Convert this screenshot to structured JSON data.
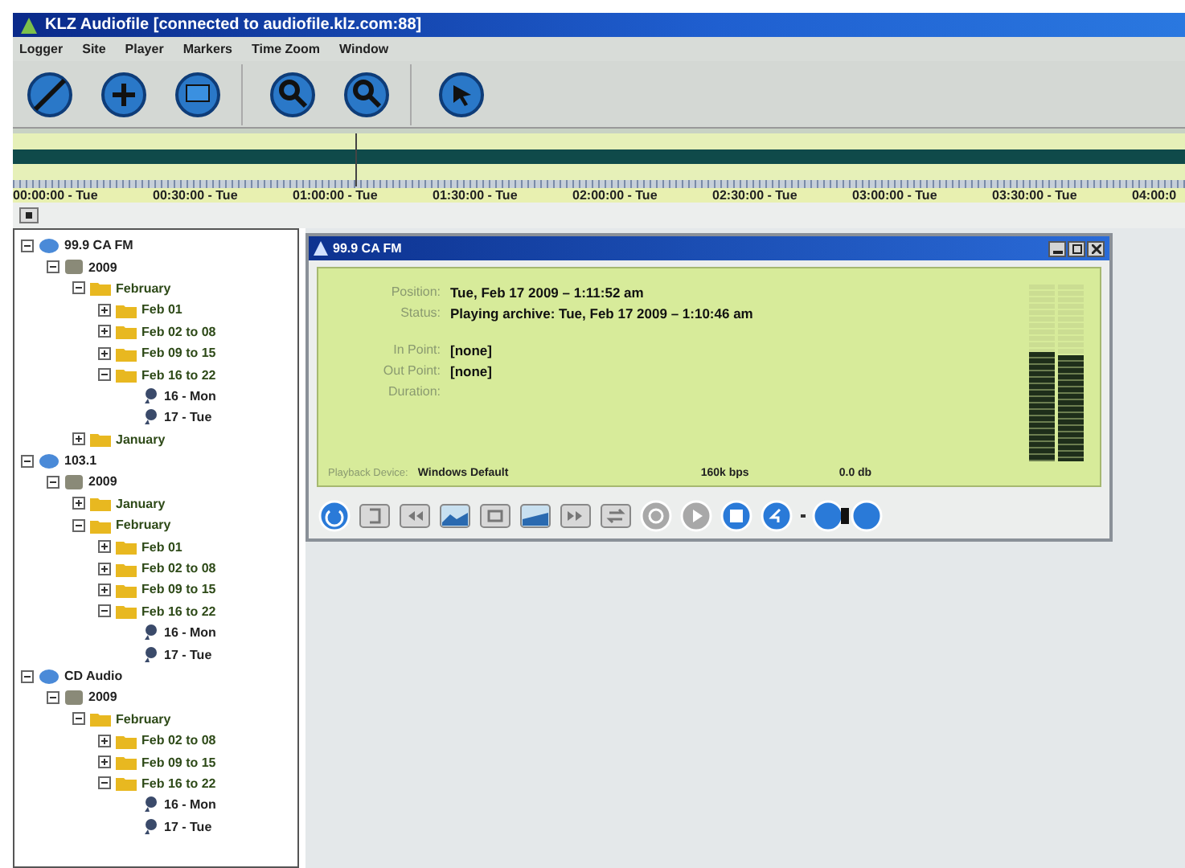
{
  "window": {
    "title": "KLZ Audiofile [connected to audiofile.klz.com:88]"
  },
  "menu": [
    "Logger",
    "Site",
    "Player",
    "Markers",
    "Time Zoom",
    "Window"
  ],
  "timeline": {
    "labels": [
      "00:00:00 - Tue",
      "00:30:00 - Tue",
      "01:00:00 - Tue",
      "01:30:00 - Tue",
      "02:00:00 - Tue",
      "02:30:00 - Tue",
      "03:00:00 - Tue",
      "03:30:00 - Tue",
      "04:00:0"
    ]
  },
  "tree": [
    {
      "label": "99.9 CA FM",
      "kind": "station",
      "expanded": true,
      "children": [
        {
          "label": "2009",
          "kind": "year",
          "expanded": true,
          "children": [
            {
              "label": "February",
              "kind": "folder",
              "expanded": true,
              "children": [
                {
                  "label": "Feb 01",
                  "kind": "folder",
                  "expanded": false
                },
                {
                  "label": "Feb 02 to 08",
                  "kind": "folder",
                  "expanded": false
                },
                {
                  "label": "Feb 09 to 15",
                  "kind": "folder",
                  "expanded": false
                },
                {
                  "label": "Feb 16 to 22",
                  "kind": "folder",
                  "expanded": true,
                  "children": [
                    {
                      "label": "16 - Mon",
                      "kind": "day"
                    },
                    {
                      "label": "17 - Tue",
                      "kind": "day"
                    }
                  ]
                }
              ]
            },
            {
              "label": "January",
              "kind": "folder",
              "expanded": false
            }
          ]
        }
      ]
    },
    {
      "label": "103.1",
      "kind": "station",
      "expanded": true,
      "children": [
        {
          "label": "2009",
          "kind": "year",
          "expanded": true,
          "children": [
            {
              "label": "January",
              "kind": "folder",
              "expanded": false
            },
            {
              "label": "February",
              "kind": "folder",
              "expanded": true,
              "children": [
                {
                  "label": "Feb 01",
                  "kind": "folder",
                  "expanded": false
                },
                {
                  "label": "Feb 02 to 08",
                  "kind": "folder",
                  "expanded": false
                },
                {
                  "label": "Feb 09 to 15",
                  "kind": "folder",
                  "expanded": false
                },
                {
                  "label": "Feb 16 to 22",
                  "kind": "folder",
                  "expanded": true,
                  "children": [
                    {
                      "label": "16 - Mon",
                      "kind": "day"
                    },
                    {
                      "label": "17 - Tue",
                      "kind": "day"
                    }
                  ]
                }
              ]
            }
          ]
        }
      ]
    },
    {
      "label": "CD Audio",
      "kind": "station",
      "expanded": true,
      "children": [
        {
          "label": "2009",
          "kind": "year",
          "expanded": true,
          "children": [
            {
              "label": "February",
              "kind": "folder",
              "expanded": true,
              "children": [
                {
                  "label": "Feb 02 to 08",
                  "kind": "folder",
                  "expanded": false
                },
                {
                  "label": "Feb 09 to 15",
                  "kind": "folder",
                  "expanded": false
                },
                {
                  "label": "Feb 16 to 22",
                  "kind": "folder",
                  "expanded": true,
                  "children": [
                    {
                      "label": "16 - Mon",
                      "kind": "day"
                    },
                    {
                      "label": "17 - Tue",
                      "kind": "day"
                    }
                  ]
                }
              ]
            }
          ]
        }
      ]
    }
  ],
  "player": {
    "title": "99.9 CA FM",
    "fields": [
      {
        "label": "Position:",
        "value": "Tue, Feb 17 2009 – 1:11:52 am"
      },
      {
        "label": "Status:",
        "value": "Playing archive: Tue, Feb 17 2009 – 1:10:46 am"
      },
      {
        "label": "In Point:",
        "value": "[none]"
      },
      {
        "label": "Out Point:",
        "value": "[none]"
      },
      {
        "label": "Duration:"
      }
    ],
    "device_label": "Playback Device:",
    "device": "Windows Default",
    "bitrate": "160k bps",
    "gain": "0.0 db",
    "meters": [
      {
        "level": 0.62
      },
      {
        "level": 0.6
      }
    ]
  }
}
